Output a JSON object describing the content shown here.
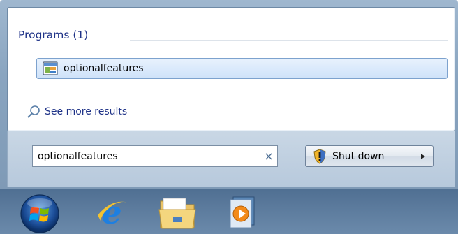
{
  "start_menu": {
    "programs_heading": "Programs (1)",
    "results": [
      {
        "label": "optionalfeatures",
        "icon": "control-panel-icon"
      }
    ],
    "see_more_label": "See more results",
    "search": {
      "value": "optionalfeatures",
      "clear_icon": "×"
    },
    "shutdown": {
      "label": "Shut down",
      "icon": "shield-icon",
      "arrow_icon": "arrow-right-icon"
    }
  },
  "taskbar": {
    "items": [
      {
        "name": "start-orb",
        "icon": "windows-logo-icon"
      },
      {
        "name": "internet-explorer",
        "icon": "internet-explorer-icon"
      },
      {
        "name": "windows-explorer",
        "icon": "folder-icon"
      },
      {
        "name": "media-player",
        "icon": "media-player-icon"
      }
    ]
  },
  "colors": {
    "heading": "#1e3287",
    "highlight_border": "#7da2ce",
    "taskbar": "#5b7a9c"
  }
}
